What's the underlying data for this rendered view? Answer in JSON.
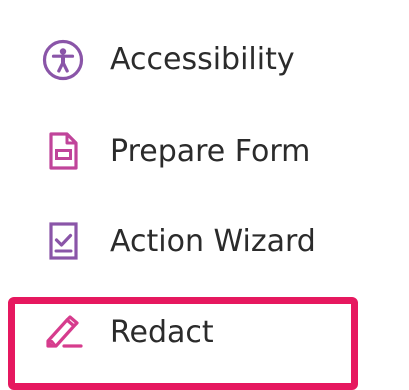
{
  "tools": [
    {
      "label": "Accessibility",
      "icon": "accessibility-icon"
    },
    {
      "label": "Prepare Form",
      "icon": "prepare-form-icon"
    },
    {
      "label": "Action Wizard",
      "icon": "action-wizard-icon"
    },
    {
      "label": "Redact",
      "icon": "redact-icon"
    }
  ],
  "colors": {
    "accessibility_icon": "#8a55a8",
    "prepare_form_icon": "#c0449a",
    "action_wizard_icon": "#8a55a8",
    "redact_icon": "#d63c8d",
    "highlight_border": "#e6185f",
    "label_text": "#2b2b2b"
  },
  "highlight": {
    "target": "Redact"
  }
}
